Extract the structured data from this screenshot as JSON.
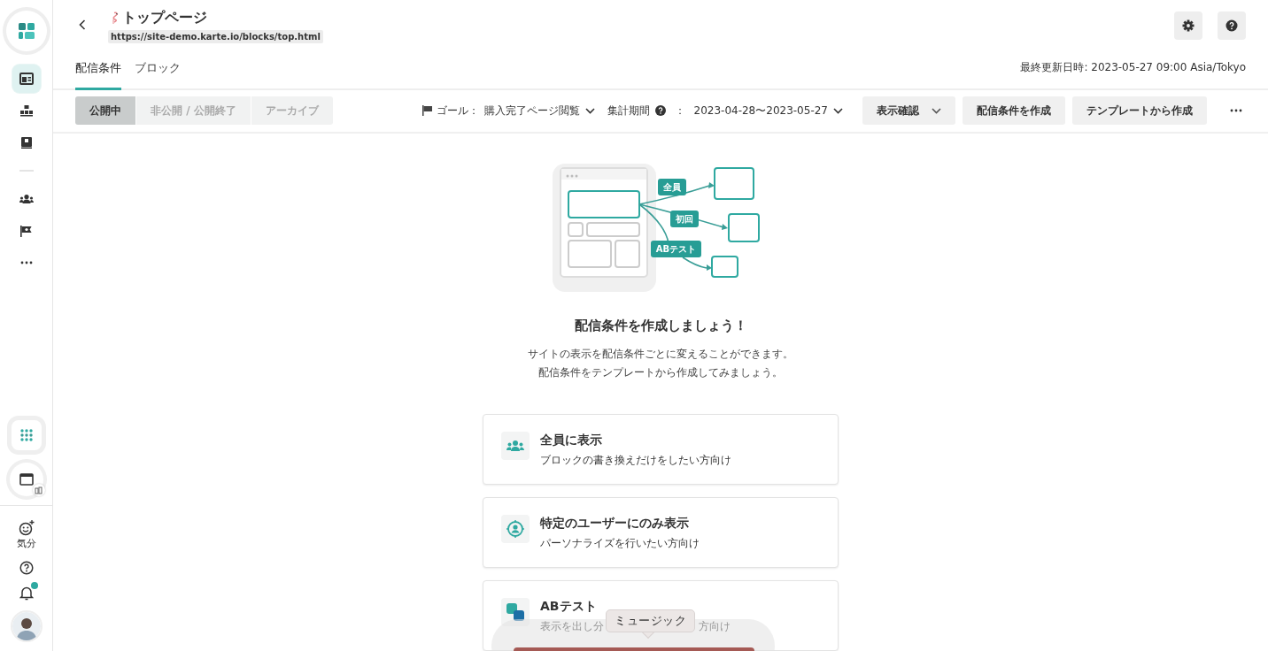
{
  "sidebar": {
    "primary": [
      {
        "kind": "layout",
        "selected": true
      },
      {
        "kind": "sitemap",
        "selected": false
      },
      {
        "kind": "book",
        "selected": false
      }
    ],
    "secondary": [
      {
        "kind": "people",
        "selected": false
      },
      {
        "kind": "flag",
        "selected": false
      },
      {
        "kind": "more",
        "selected": false
      }
    ],
    "mood_label": "気分",
    "notifications_unread": true
  },
  "page": {
    "title": "トップページ",
    "url": "https://site-demo.karte.io/blocks/top.html"
  },
  "tabs": [
    {
      "label": "配信条件",
      "selected": true
    },
    {
      "label": "ブロック",
      "selected": false
    }
  ],
  "last_updated": "最終更新日時: 2023-05-27 09:00 Asia/Tokyo",
  "status_filters": [
    {
      "label": "公開中",
      "selected": true
    },
    {
      "label": "非公開 / 公開終了",
      "selected": false
    },
    {
      "label": "アーカイブ",
      "selected": false
    }
  ],
  "goal": {
    "label": "ゴール：",
    "value": "購入完了ページ閲覧"
  },
  "period": {
    "label": "集計期間",
    "separator": "：",
    "value": "2023-04-28〜2023-05-27"
  },
  "toolbar_buttons": [
    {
      "label": "表示確認",
      "kind": "dropdown"
    },
    {
      "label": "配信条件を作成",
      "kind": "plain"
    },
    {
      "label": "テンプレートから作成",
      "kind": "plain"
    }
  ],
  "illustration": {
    "tags": [
      "全員",
      "初回",
      "ABテスト"
    ]
  },
  "empty_state": {
    "heading": "配信条件を作成しましょう！",
    "lines": [
      "サイトの表示を配信条件ごとに変えることができます。",
      "配信条件をテンプレートから作成してみましょう。"
    ]
  },
  "options": [
    {
      "kind": "everyone",
      "title": "全員に表示",
      "description": [
        "ブロックの書き換えだけをしたい方向け"
      ]
    },
    {
      "kind": "target",
      "title": "特定のユーザーにのみ表示",
      "description": [
        "パーソナライズを行いたい方向け"
      ]
    },
    {
      "kind": "ab",
      "title": "ABテスト",
      "description": [
        "表示を出し分",
        "方向け"
      ]
    }
  ],
  "dock": {
    "tooltip": "ミュージック"
  }
}
